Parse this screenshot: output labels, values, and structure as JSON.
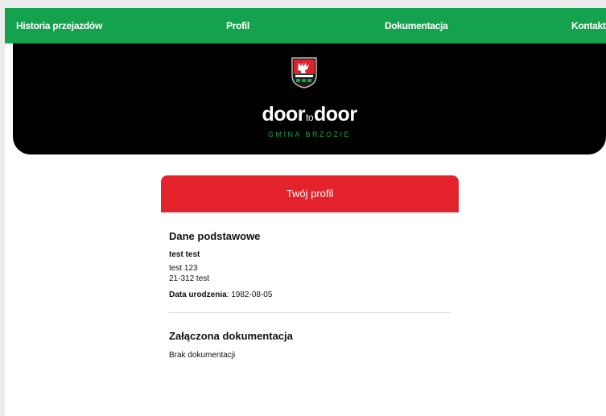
{
  "nav": {
    "items": [
      {
        "label": "Historia przejazdów"
      },
      {
        "label": "Profil"
      },
      {
        "label": "Dokumentacja"
      },
      {
        "label": "Kontakt"
      }
    ]
  },
  "header": {
    "logo_left": "door",
    "logo_mid": "to",
    "logo_right": "door",
    "subtitle": "GMINA BRZOZIE"
  },
  "profile": {
    "card_title": "Twój profil",
    "basic_section_title": "Dane podstawowe",
    "name": "test test",
    "address_line1": "test 123",
    "address_line2": "21-312 test",
    "birth_label": "Data urodzenia",
    "birth_value": "1982-08-05",
    "docs_section_title": "Załączona dokumentacja",
    "docs_empty": "Brak dokumentacji"
  },
  "colors": {
    "nav_bg": "#15a24f",
    "accent_red": "#e3222b",
    "hero_bg": "#000000"
  }
}
